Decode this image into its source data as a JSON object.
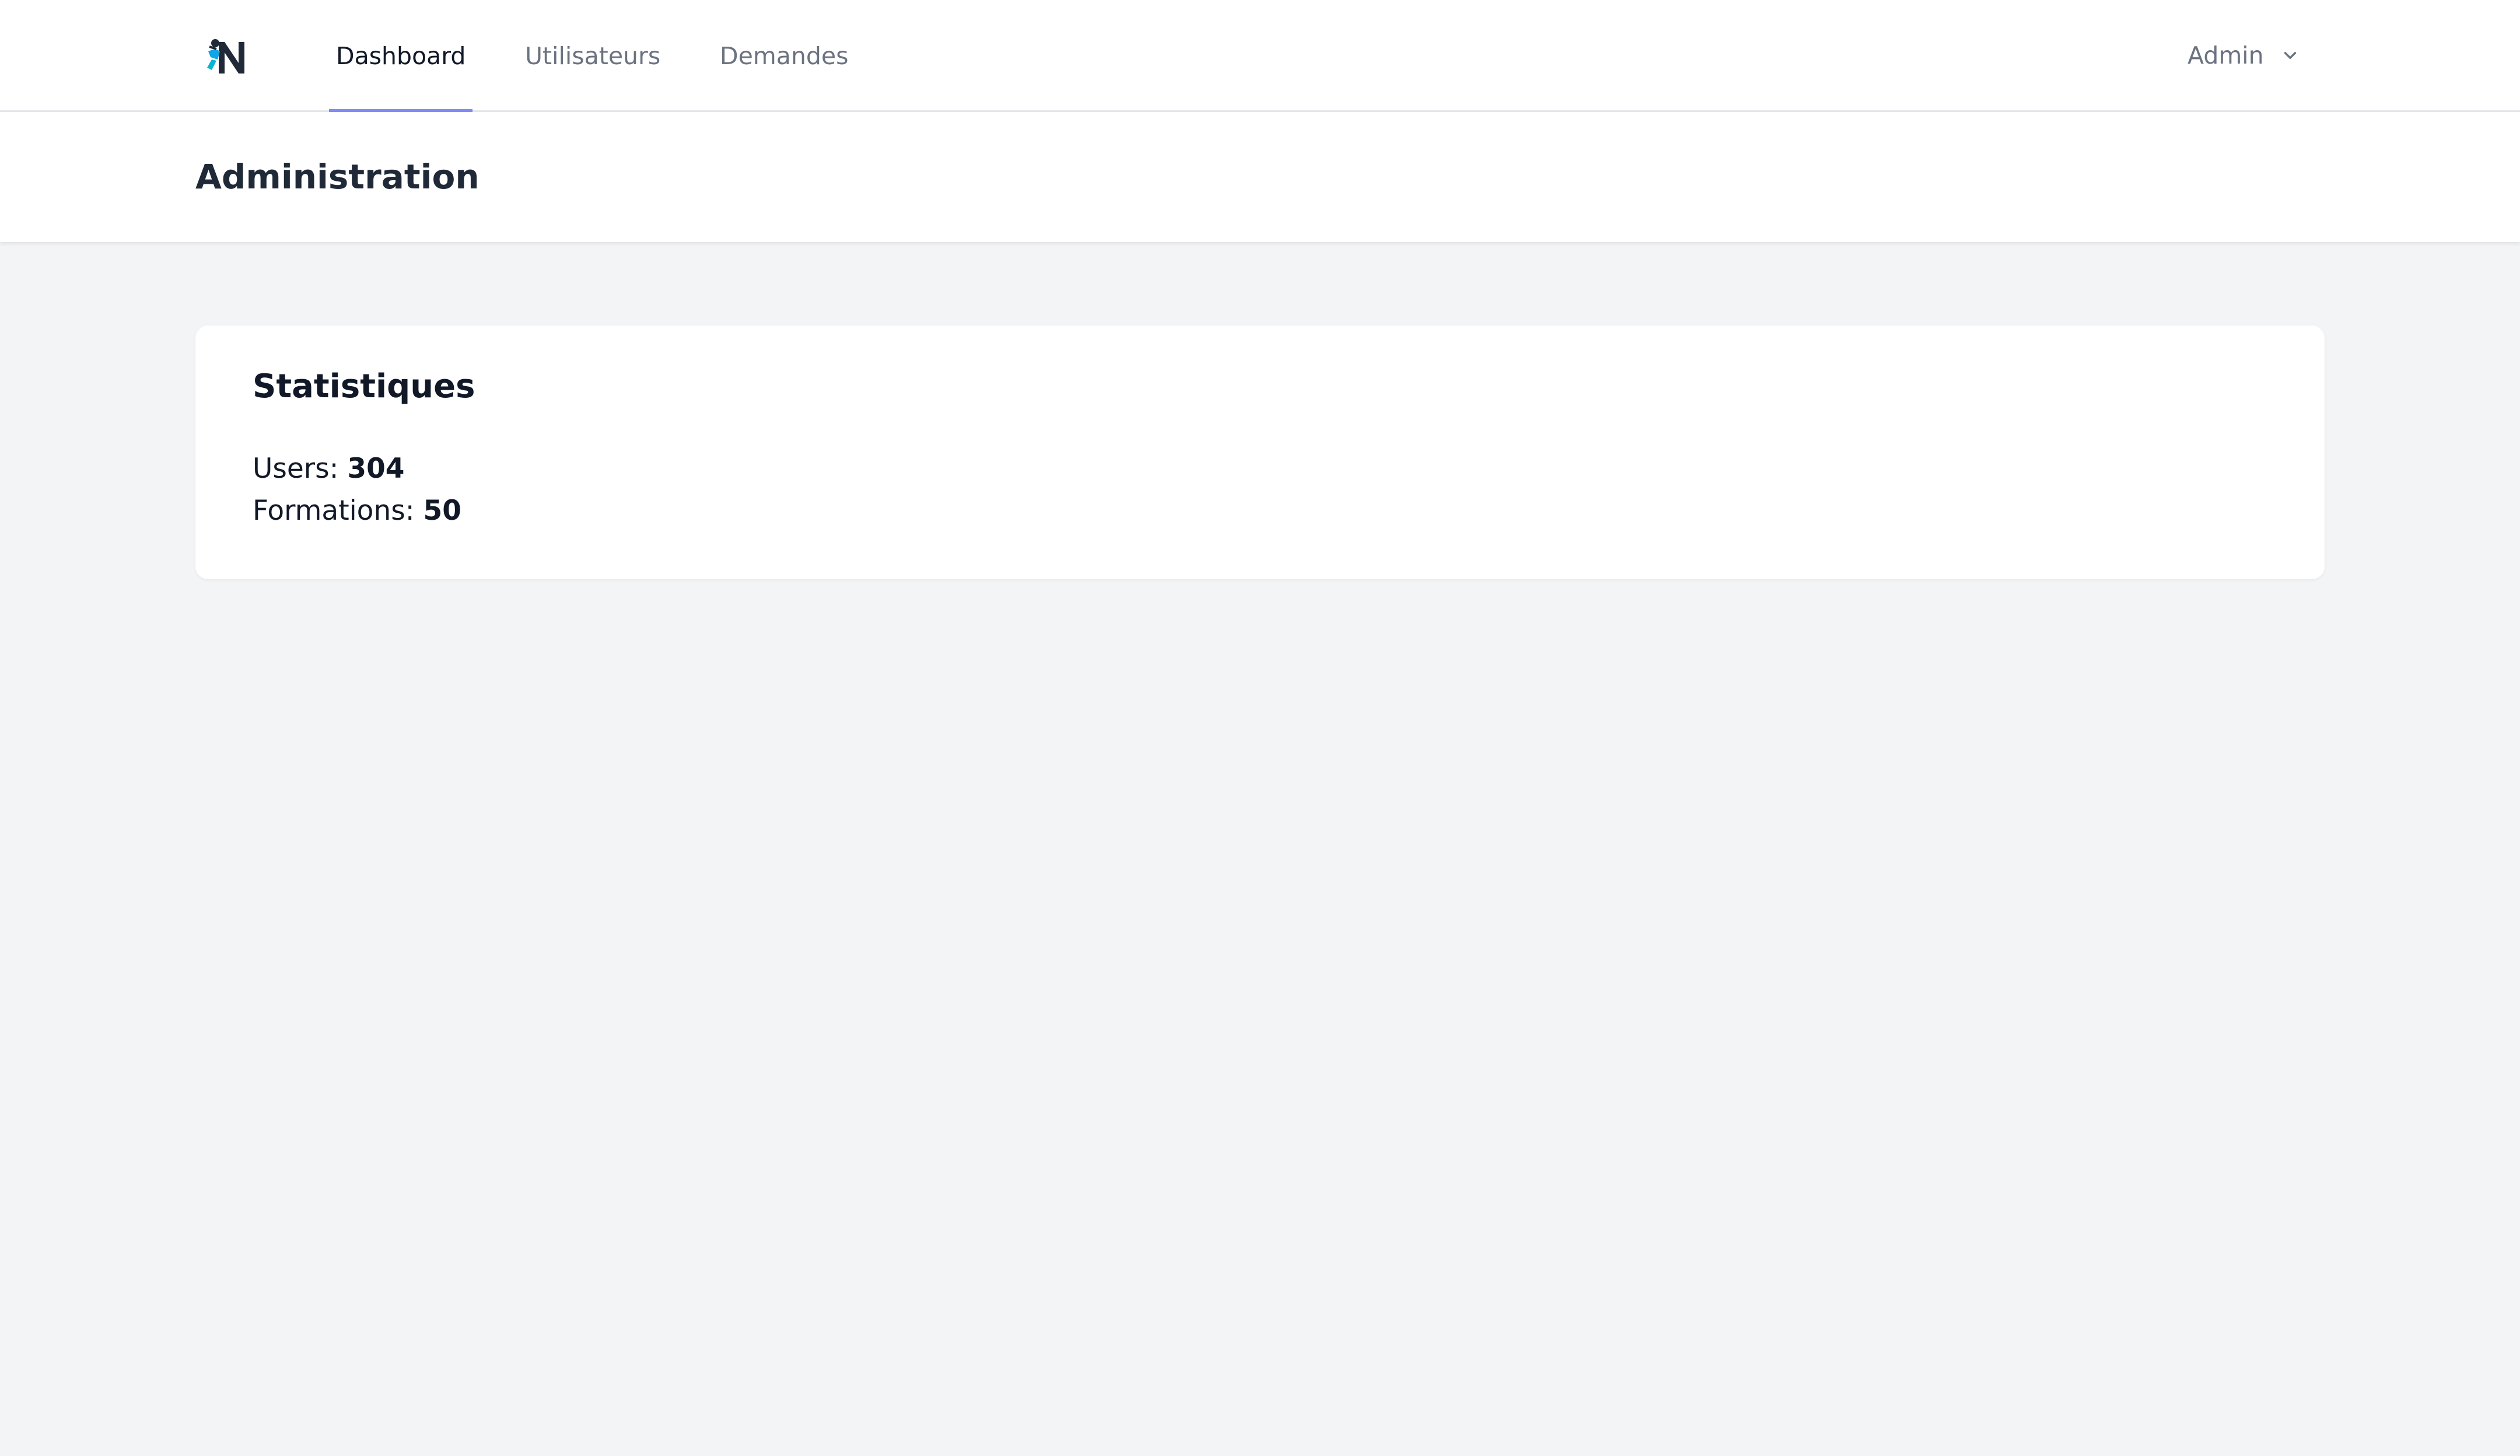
{
  "nav": {
    "logo_name": "app-logo",
    "links": [
      {
        "label": "Dashboard",
        "active": true
      },
      {
        "label": "Utilisateurs",
        "active": false
      },
      {
        "label": "Demandes",
        "active": false
      }
    ],
    "user_menu": {
      "label": "Admin",
      "icon": "chevron-down-icon"
    },
    "accent_color": "#818cf8"
  },
  "header": {
    "title": "Administration"
  },
  "stats_card": {
    "title": "Statistiques",
    "items": [
      {
        "label": "Users:",
        "value": "304"
      },
      {
        "label": "Formations:",
        "value": "50"
      }
    ]
  }
}
